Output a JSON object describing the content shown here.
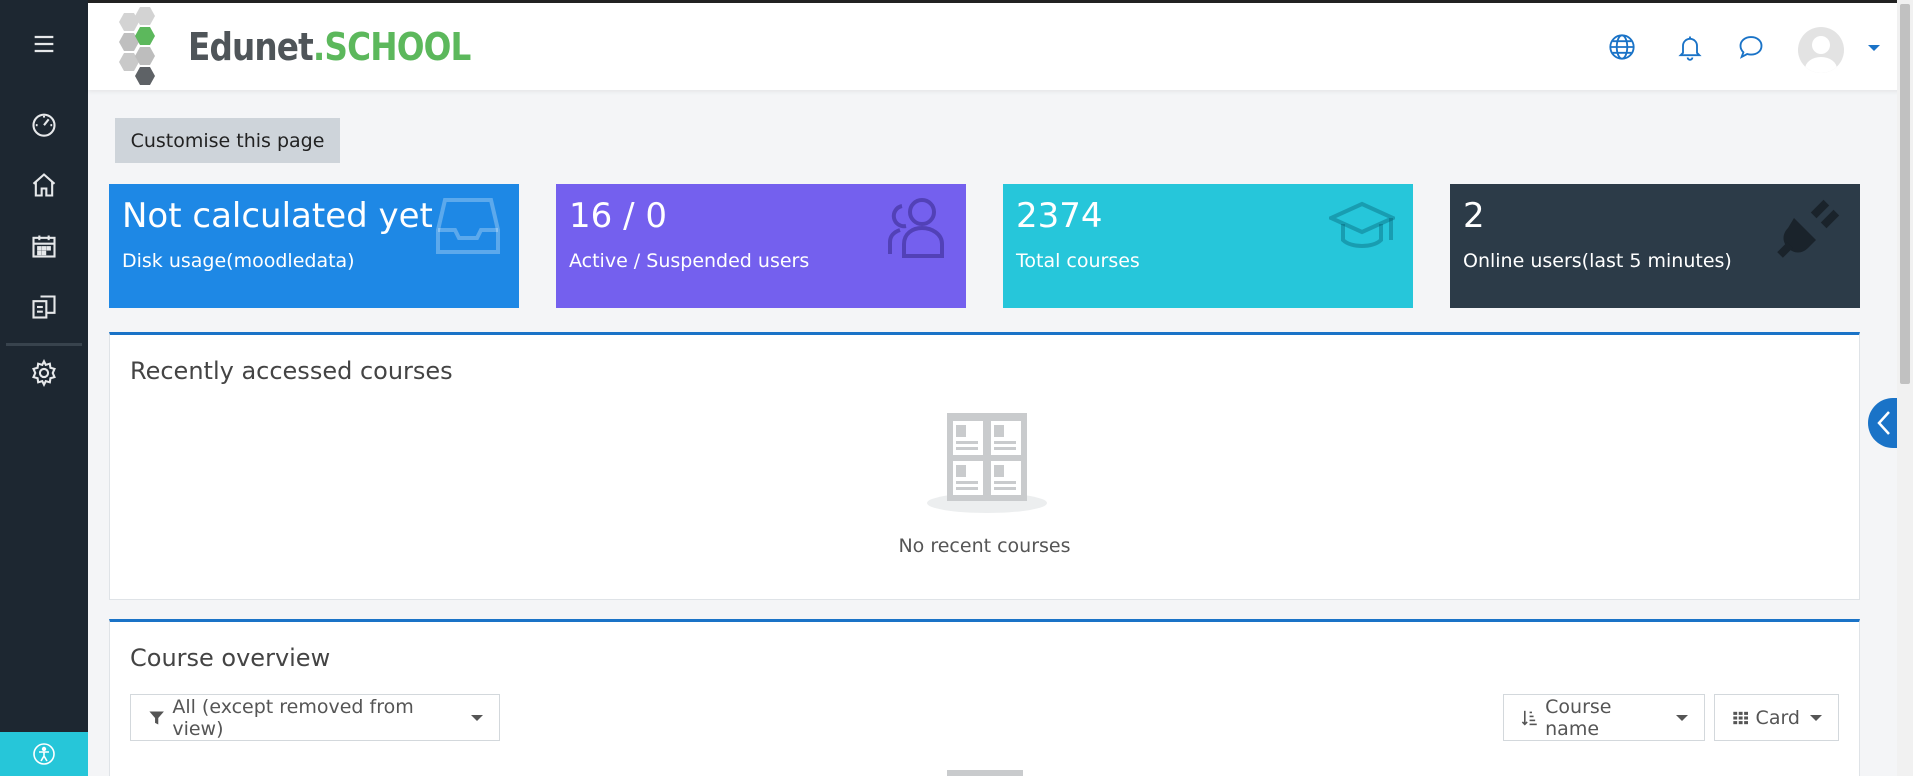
{
  "brand": {
    "name_part1": "Edunet",
    "name_part2": ".SCHOOL"
  },
  "sidebar": {
    "items": [
      {
        "icon": "menu-icon"
      },
      {
        "icon": "dashboard-icon"
      },
      {
        "icon": "home-icon"
      },
      {
        "icon": "calendar-icon"
      },
      {
        "icon": "files-icon"
      },
      {
        "icon": "gear-icon"
      }
    ],
    "accessibility_icon": "accessibility-icon"
  },
  "topbar": {
    "icons": [
      "globe-icon",
      "bell-icon",
      "chat-icon",
      "avatar",
      "chevron-down-icon"
    ]
  },
  "customise_label": "Customise this page",
  "stats": [
    {
      "value": "Not calculated yet",
      "label": "Disk usage(moodledata)",
      "icon": "inbox-icon",
      "color": "#1e88e5"
    },
    {
      "value": "16 / 0",
      "label": "Active / Suspended users",
      "icon": "users-icon",
      "color": "#7460ee"
    },
    {
      "value": "2374",
      "label": "Total courses",
      "icon": "graduation-cap-icon",
      "color": "#26c6da"
    },
    {
      "value": "2",
      "label": "Online users(last 5 minutes)",
      "icon": "plug-icon",
      "color": "#2c3b48"
    }
  ],
  "recent": {
    "title": "Recently accessed courses",
    "empty_text": "No recent courses"
  },
  "overview": {
    "title": "Course overview",
    "filter_label": "All (except removed from view)",
    "sort_label": "Course name",
    "view_label": "Card"
  },
  "accent_color": "#1a73c7"
}
